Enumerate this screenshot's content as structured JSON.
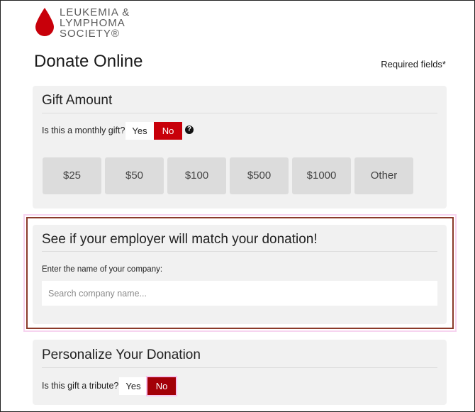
{
  "brand": {
    "logo_lines": [
      "LEUKEMIA &",
      "LYMPHOMA",
      "SOCIETY®"
    ],
    "drop_color": "#c8000a"
  },
  "page": {
    "title": "Donate Online",
    "required_note": "Required fields*"
  },
  "gift_amount": {
    "heading": "Gift Amount",
    "monthly_question": "Is this a monthly gift?",
    "yes_label": "Yes",
    "no_label": "No",
    "selected": "No",
    "help_icon": "question-circle-icon",
    "amounts": [
      "$25",
      "$50",
      "$100",
      "$500",
      "$1000",
      "Other"
    ]
  },
  "employer_match": {
    "heading": "See if your employer will match your donation!",
    "company_label": "Enter the name of your company:",
    "search_placeholder": "Search company name...",
    "search_value": ""
  },
  "personalize": {
    "heading": "Personalize Your Donation",
    "tribute_question": "Is this gift a tribute?",
    "yes_label": "Yes",
    "no_label": "No",
    "selected": "No"
  },
  "colors": {
    "accent_red": "#c8000a",
    "panel_bg": "#f1f1f1",
    "amount_bg": "#dcdcdc",
    "highlight_border": "#8b3a2a"
  }
}
